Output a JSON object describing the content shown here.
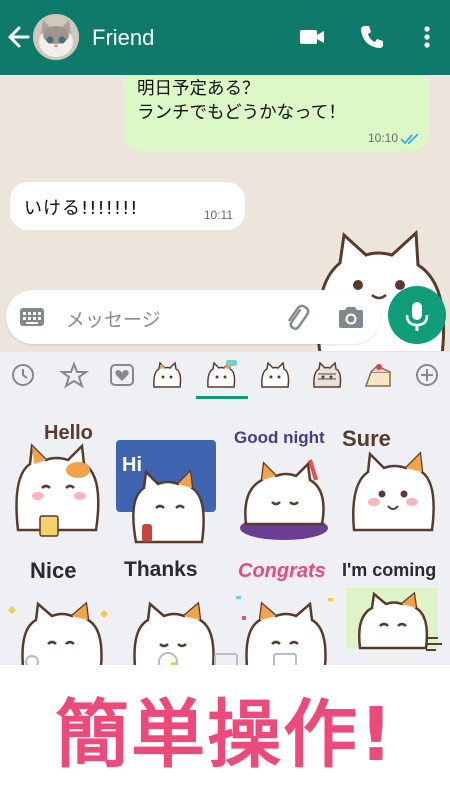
{
  "header": {
    "contact_name": "Friend",
    "back_icon": "arrow-left-icon",
    "video_icon": "video-camera-icon",
    "call_icon": "phone-icon",
    "menu_icon": "more-vertical-icon",
    "color": "#0f7a69"
  },
  "messages": [
    {
      "direction": "outgoing",
      "lines": [
        "明日予定ある？",
        "ランチでもどうかなって！"
      ],
      "time": "10:10",
      "status": "read"
    },
    {
      "direction": "incoming",
      "text": "いける!!!!!!!",
      "time": "10:11"
    }
  ],
  "composer": {
    "placeholder": "メッセージ"
  },
  "sticker_tabs": [
    "recent-icon",
    "favorite-star-icon",
    "heart-icon",
    "cat-pack-1",
    "cat-pack-2",
    "cat-pack-3",
    "cat-pack-4",
    "cat-pack-5",
    "add-icon"
  ],
  "stickers": [
    {
      "label": "Hello"
    },
    {
      "label": "Hi"
    },
    {
      "label": "Good night"
    },
    {
      "label": "Sure"
    },
    {
      "label": "Nice"
    },
    {
      "label": "Thanks"
    },
    {
      "label": "Congrats"
    },
    {
      "label": "I'm coming"
    }
  ],
  "banner": {
    "text": "簡単操作!"
  },
  "colors": {
    "accent": "#0f9d7a",
    "outgoing_bubble": "#dcf8c6",
    "banner_text": "#ec4a7a",
    "chat_bg": "#ece5dc"
  }
}
